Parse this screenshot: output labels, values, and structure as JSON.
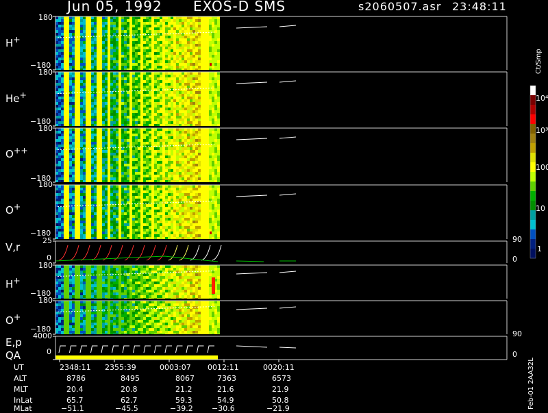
{
  "header": {
    "date": "Jun 05, 1992",
    "instrument": "EXOS-D SMS",
    "file": "s2060507.asr",
    "time": "23:48:11"
  },
  "colorbar": {
    "unit": "Ct/Smp",
    "ticks": [
      "10⁴",
      "10³",
      "100",
      "10",
      "1"
    ],
    "colors": [
      "#ffffff",
      "#7a0000",
      "#b00000",
      "#ff0000",
      "#806000",
      "#a08010",
      "#c0a000",
      "#e0e000",
      "#ffff00",
      "#c0ff00",
      "#60d000",
      "#00b000",
      "#009000",
      "#00a0a0",
      "#00c0d0",
      "#0050c0",
      "#002080",
      "#001060"
    ]
  },
  "chart_data": {
    "type": "heatmap",
    "panels": [
      {
        "label": "H+",
        "ymax": "180",
        "ymin": "−180"
      },
      {
        "label": "He+",
        "ymax": "180",
        "ymin": "−180"
      },
      {
        "label": "O++",
        "ymax": "180",
        "ymin": "−180"
      },
      {
        "label": "O+",
        "ymax": "180",
        "ymin": "−180"
      },
      {
        "label": "V,r",
        "ymax": "25",
        "ymin": "0",
        "right_max": "90",
        "right_min": "0"
      },
      {
        "label": "H+",
        "ymax": "180",
        "ymin": "−180"
      },
      {
        "label": "O+",
        "ymax": "180",
        "ymin": "−180"
      },
      {
        "label": "E,p",
        "label2": "QA",
        "ymax": "4000",
        "ymin": "0",
        "right_max": "90",
        "right_min": "0"
      }
    ],
    "x_ut": [
      "2348:11",
      "2355:39",
      "0003:07",
      "0012:11",
      "0020:11"
    ],
    "footer_rows": [
      {
        "name": "UT",
        "values": [
          "2348:11",
          "2355:39",
          "0003:07",
          "0012:11",
          "0020:11"
        ]
      },
      {
        "name": "ALT",
        "values": [
          "8786",
          "8495",
          "8067",
          "7363",
          "6573"
        ]
      },
      {
        "name": "MLT",
        "values": [
          "20.4",
          "20.8",
          "21.2",
          "21.6",
          "21.9"
        ]
      },
      {
        "name": "InLat",
        "values": [
          "65.7",
          "62.7",
          "59.3",
          "54.9",
          "50.8"
        ]
      },
      {
        "name": "MLat",
        "values": [
          "−51.1",
          "−45.5",
          "−39.2",
          "−30.6",
          "−21.9"
        ]
      }
    ]
  },
  "side_note": "Feb-01 2AA32L"
}
